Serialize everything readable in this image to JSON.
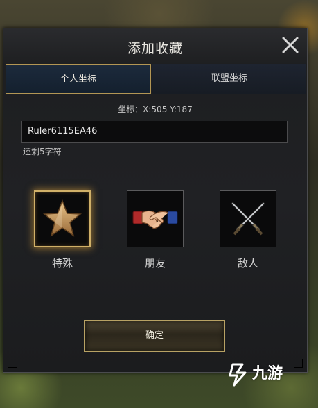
{
  "dialog": {
    "title": "添加收藏",
    "close_icon": "close-icon"
  },
  "tabs": [
    {
      "label": "个人坐标",
      "active": true
    },
    {
      "label": "联盟坐标",
      "active": false
    }
  ],
  "coordinates_text": "坐标：X:505 Y:187",
  "name_input": {
    "value": "Ruler6115EA46"
  },
  "remaining_text": "还剩5字符",
  "categories": [
    {
      "label": "特殊",
      "icon": "star-icon",
      "selected": true
    },
    {
      "label": "朋友",
      "icon": "handshake-icon",
      "selected": false
    },
    {
      "label": "敌人",
      "icon": "crossed-swords-icon",
      "selected": false
    }
  ],
  "confirm_label": "确定",
  "watermark": {
    "text": "九游",
    "icon": "jiuyou-logo-icon"
  },
  "colors": {
    "accent_gold": "#b8a264",
    "selected_glow": "#e6aa3c",
    "panel_bg": "#1f2023",
    "active_tab_bg": "#1c2a3c"
  }
}
